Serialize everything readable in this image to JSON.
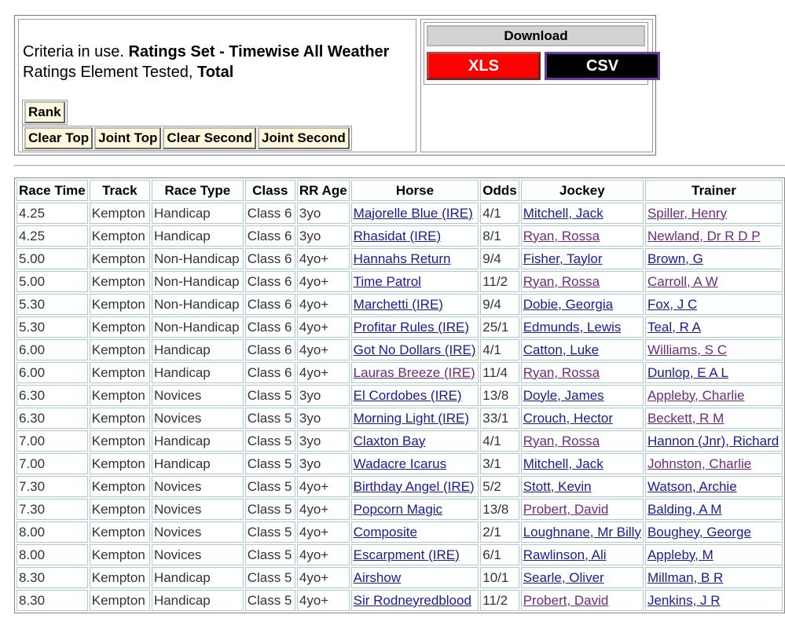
{
  "criteria": {
    "prefix1": "Criteria in use. ",
    "ratings_set": "Ratings Set - Timewise All Weather",
    "prefix2": "Ratings Element Tested, ",
    "element": "Total"
  },
  "rank_button": "Rank",
  "sort_buttons": [
    "Clear Top",
    "Joint Top",
    "Clear Second",
    "Joint Second"
  ],
  "download": {
    "label": "Download",
    "xls": "XLS",
    "csv": "CSV",
    "xls_color": "#ff0000",
    "csv_color": "#000000"
  },
  "link_colors": {
    "link": "#1a1a99",
    "visited": "#6b2c7e"
  },
  "table": {
    "headers": [
      "Race Time",
      "Track",
      "Race Type",
      "Class",
      "RR Age",
      "Horse",
      "Odds",
      "Jockey",
      "Trainer"
    ],
    "rows": [
      {
        "time": "4.25",
        "track": "Kempton",
        "type": "Handicap",
        "class": "Class 6",
        "age": "3yo",
        "horse": "Majorelle Blue (IRE)",
        "odds": "4/1",
        "jockey": "Mitchell, Jack",
        "trainer": "Spiller, Henry",
        "jockey_visited": false,
        "trainer_visited": true,
        "horse_visited": false
      },
      {
        "time": "4.25",
        "track": "Kempton",
        "type": "Handicap",
        "class": "Class 6",
        "age": "3yo",
        "horse": "Rhasidat (IRE)",
        "odds": "8/1",
        "jockey": "Ryan, Rossa",
        "trainer": "Newland, Dr R D P",
        "jockey_visited": true,
        "trainer_visited": true,
        "horse_visited": false
      },
      {
        "time": "5.00",
        "track": "Kempton",
        "type": "Non-Handicap",
        "class": "Class 6",
        "age": "4yo+",
        "horse": "Hannahs Return",
        "odds": "9/4",
        "jockey": "Fisher, Taylor",
        "trainer": "Brown, G",
        "jockey_visited": false,
        "trainer_visited": false,
        "horse_visited": false
      },
      {
        "time": "5.00",
        "track": "Kempton",
        "type": "Non-Handicap",
        "class": "Class 6",
        "age": "4yo+",
        "horse": "Time Patrol",
        "odds": "11/2",
        "jockey": "Ryan, Rossa",
        "trainer": "Carroll, A W",
        "jockey_visited": true,
        "trainer_visited": true,
        "horse_visited": false
      },
      {
        "time": "5.30",
        "track": "Kempton",
        "type": "Non-Handicap",
        "class": "Class 6",
        "age": "4yo+",
        "horse": "Marchetti (IRE)",
        "odds": "9/4",
        "jockey": "Dobie, Georgia",
        "trainer": "Fox, J C",
        "jockey_visited": false,
        "trainer_visited": false,
        "horse_visited": false
      },
      {
        "time": "5.30",
        "track": "Kempton",
        "type": "Non-Handicap",
        "class": "Class 6",
        "age": "4yo+",
        "horse": "Profitar Rules (IRE)",
        "odds": "25/1",
        "jockey": "Edmunds, Lewis",
        "trainer": "Teal, R A",
        "jockey_visited": false,
        "trainer_visited": false,
        "horse_visited": false
      },
      {
        "time": "6.00",
        "track": "Kempton",
        "type": "Handicap",
        "class": "Class 6",
        "age": "4yo+",
        "horse": "Got No Dollars (IRE)",
        "odds": "4/1",
        "jockey": "Catton, Luke",
        "trainer": "Williams, S C",
        "jockey_visited": false,
        "trainer_visited": true,
        "horse_visited": false
      },
      {
        "time": "6.00",
        "track": "Kempton",
        "type": "Handicap",
        "class": "Class 6",
        "age": "4yo+",
        "horse": "Lauras Breeze (IRE)",
        "odds": "11/4",
        "jockey": "Ryan, Rossa",
        "trainer": "Dunlop, E A L",
        "jockey_visited": true,
        "trainer_visited": false,
        "horse_visited": true
      },
      {
        "time": "6.30",
        "track": "Kempton",
        "type": "Novices",
        "class": "Class 5",
        "age": "3yo",
        "horse": "El Cordobes (IRE)",
        "odds": "13/8",
        "jockey": "Doyle, James",
        "trainer": "Appleby, Charlie",
        "jockey_visited": false,
        "trainer_visited": true,
        "horse_visited": false
      },
      {
        "time": "6.30",
        "track": "Kempton",
        "type": "Novices",
        "class": "Class 5",
        "age": "3yo",
        "horse": "Morning Light (IRE)",
        "odds": "33/1",
        "jockey": "Crouch, Hector",
        "trainer": "Beckett, R M",
        "jockey_visited": false,
        "trainer_visited": true,
        "horse_visited": false
      },
      {
        "time": "7.00",
        "track": "Kempton",
        "type": "Handicap",
        "class": "Class 5",
        "age": "3yo",
        "horse": "Claxton Bay",
        "odds": "4/1",
        "jockey": "Ryan, Rossa",
        "trainer": "Hannon (Jnr), Richard",
        "jockey_visited": true,
        "trainer_visited": false,
        "horse_visited": false
      },
      {
        "time": "7.00",
        "track": "Kempton",
        "type": "Handicap",
        "class": "Class 5",
        "age": "3yo",
        "horse": "Wadacre Icarus",
        "odds": "3/1",
        "jockey": "Mitchell, Jack",
        "trainer": "Johnston, Charlie",
        "jockey_visited": false,
        "trainer_visited": true,
        "horse_visited": false
      },
      {
        "time": "7.30",
        "track": "Kempton",
        "type": "Novices",
        "class": "Class 5",
        "age": "4yo+",
        "horse": "Birthday Angel (IRE)",
        "odds": "5/2",
        "jockey": "Stott, Kevin",
        "trainer": "Watson, Archie",
        "jockey_visited": false,
        "trainer_visited": false,
        "horse_visited": false
      },
      {
        "time": "7.30",
        "track": "Kempton",
        "type": "Novices",
        "class": "Class 5",
        "age": "4yo+",
        "horse": "Popcorn Magic",
        "odds": "13/8",
        "jockey": "Probert, David",
        "trainer": "Balding, A M",
        "jockey_visited": true,
        "trainer_visited": false,
        "horse_visited": false
      },
      {
        "time": "8.00",
        "track": "Kempton",
        "type": "Novices",
        "class": "Class 5",
        "age": "4yo+",
        "horse": "Composite",
        "odds": "2/1",
        "jockey": "Loughnane, Mr Billy",
        "trainer": "Boughey, George",
        "jockey_visited": false,
        "trainer_visited": false,
        "horse_visited": false
      },
      {
        "time": "8.00",
        "track": "Kempton",
        "type": "Novices",
        "class": "Class 5",
        "age": "4yo+",
        "horse": "Escarpment (IRE)",
        "odds": "6/1",
        "jockey": "Rawlinson, Ali",
        "trainer": "Appleby, M",
        "jockey_visited": false,
        "trainer_visited": false,
        "horse_visited": false
      },
      {
        "time": "8.30",
        "track": "Kempton",
        "type": "Handicap",
        "class": "Class 5",
        "age": "4yo+",
        "horse": "Airshow",
        "odds": "10/1",
        "jockey": "Searle, Oliver",
        "trainer": "Millman, B R",
        "jockey_visited": false,
        "trainer_visited": false,
        "horse_visited": false
      },
      {
        "time": "8.30",
        "track": "Kempton",
        "type": "Handicap",
        "class": "Class 5",
        "age": "4yo+",
        "horse": "Sir Rodneyredblood",
        "odds": "11/2",
        "jockey": "Probert, David",
        "trainer": "Jenkins, J R",
        "jockey_visited": true,
        "trainer_visited": false,
        "horse_visited": false
      }
    ]
  }
}
